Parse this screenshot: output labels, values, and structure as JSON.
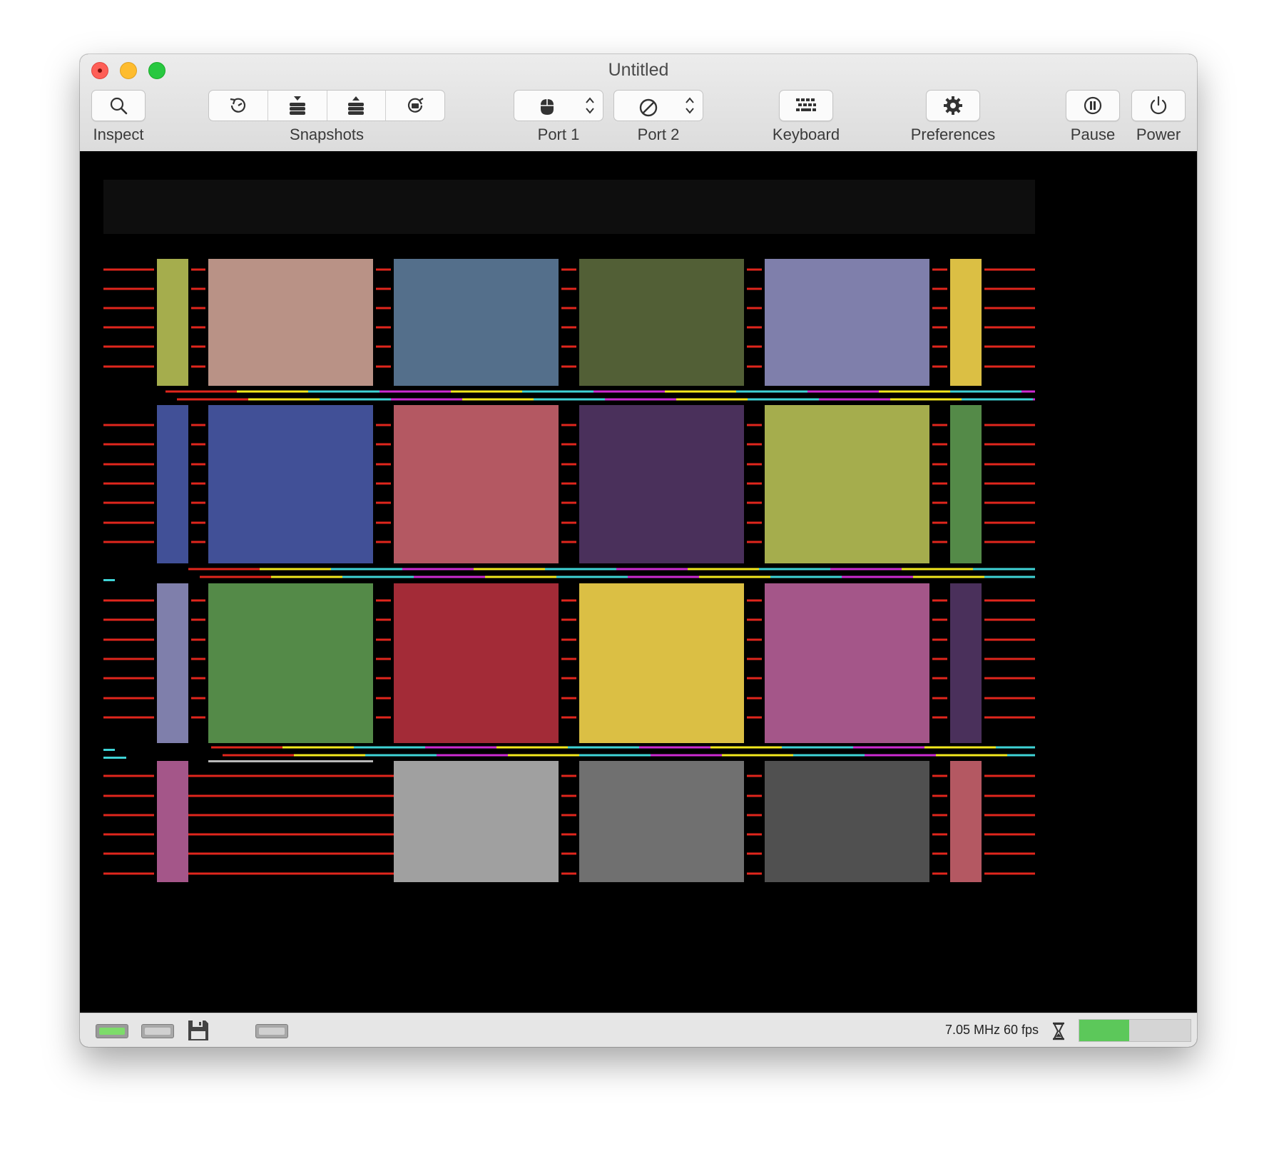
{
  "window": {
    "title": "Untitled"
  },
  "toolbar": {
    "inspect_label": "Inspect",
    "snapshots_label": "Snapshots",
    "port1_label": "Port 1",
    "port2_label": "Port 2",
    "keyboard_label": "Keyboard",
    "preferences_label": "Preferences",
    "pause_label": "Pause",
    "power_label": "Power",
    "icons": {
      "inspect": "magnifier-icon",
      "snapshot_take": "clock-arrow-icon",
      "snapshot_save": "stack-down-icon",
      "snapshot_restore": "stack-up-icon",
      "snapshot_browse": "rotate-folder-icon",
      "port1": "mouse-icon",
      "port2": "no-device-icon",
      "keyboard": "keyboard-icon",
      "preferences": "gear-icon",
      "pause": "pause-icon",
      "power": "power-icon"
    }
  },
  "emulator_screen": {
    "background": "#000000",
    "raster_line_color": "#e0261d",
    "accent_line_colors": [
      "#e0261d",
      "#f2e81e",
      "#3fd3d6",
      "#cc2bd1",
      "#b9b9b9"
    ],
    "palette_grid": [
      [
        "#a5ad4d",
        "#b99286",
        "#546f8b",
        "#525f36",
        "#7f7fab",
        "#dbbf44"
      ],
      [
        "#415097",
        "#415097",
        "#b45862",
        "#4a305b",
        "#a5ad4d",
        "#548a48"
      ],
      [
        "#7f7fab",
        "#548a48",
        "#a32b37",
        "#dbbf44",
        "#a45689",
        "#4a305b"
      ],
      [
        "#a45689",
        "#000000",
        "#a0a0a0",
        "#707070",
        "#505050",
        "#b45862"
      ]
    ]
  },
  "statusbar": {
    "speed_text": "7.05 MHz 60 fps",
    "warp_gauge_fraction": 0.45,
    "drive1_led_color": "#7ddc6a",
    "icons": {
      "drive1": "disk-drive-led-icon",
      "drive2": "disk-drive-icon",
      "disk": "floppy-disk-icon",
      "cartridge": "cartridge-icon",
      "warp": "hourglass-icon"
    }
  }
}
